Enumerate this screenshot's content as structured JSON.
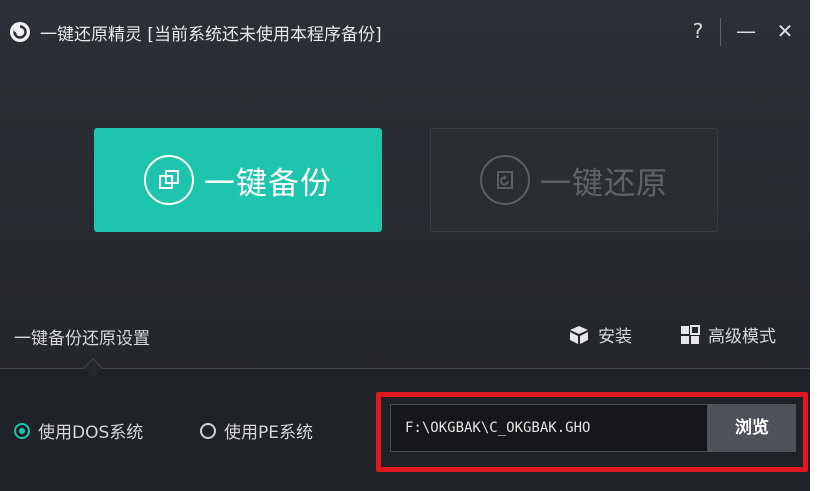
{
  "window": {
    "title": "一键还原精灵 [当前系统还未使用本程序备份]",
    "help_label": "?",
    "minimize_label": "—",
    "close_label": "✕"
  },
  "actions": {
    "backup_label": "一键备份",
    "restore_label": "一键还原"
  },
  "settings": {
    "section_label": "一键备份还原设置",
    "install_label": "安装",
    "advanced_label": "高级模式"
  },
  "boot_options": {
    "selected": "dos",
    "dos_label": "使用DOS系统",
    "pe_label": "使用PE系统"
  },
  "backup_path": {
    "value": "F:\\OKGBAK\\C_OKGBAK.GHO",
    "browse_label": "浏览"
  },
  "colors": {
    "accent": "#1fc4ae",
    "highlight": "#e01820",
    "window_bg": "#2a2d32"
  },
  "icons": [
    "app-logo-icon",
    "backup-copy-icon",
    "restore-icon",
    "install-box-icon",
    "grid-mode-icon"
  ]
}
